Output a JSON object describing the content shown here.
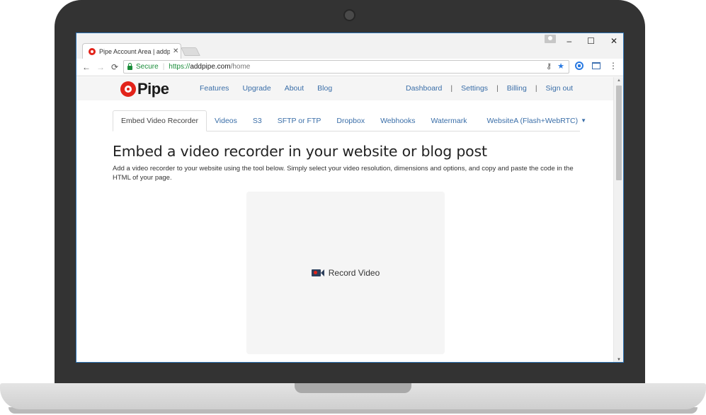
{
  "browser": {
    "tab_title": "Pipe Account Area | addp",
    "tab_close": "✕",
    "window_controls": {
      "minimize": "–",
      "maximize": "☐",
      "close": "✕"
    },
    "nav": {
      "back": "←",
      "forward": "→",
      "reload": "⟳"
    },
    "omnibox": {
      "secure_label": "Secure",
      "separator": "|",
      "url_protocol": "https://",
      "url_host": "addpipe.com",
      "url_path": "/home"
    },
    "menu": "⋮"
  },
  "site": {
    "logo_text": "Pipe",
    "nav_left": [
      "Features",
      "Upgrade",
      "About",
      "Blog"
    ],
    "nav_right": [
      "Dashboard",
      "Settings",
      "Billing",
      "Sign out"
    ],
    "divider": "|"
  },
  "tabs": [
    "Embed Video Recorder",
    "Videos",
    "S3",
    "SFTP or FTP",
    "Dropbox",
    "Webhooks",
    "Watermark",
    "WebsiteA (Flash+WebRTC)"
  ],
  "tab_caret": "▼",
  "main": {
    "heading": "Embed a video recorder in your website or blog post",
    "description": "Add a video recorder to your website using the tool below. Simply select your video resolution, dimensions and options, and copy and paste the code in the HTML of your page.",
    "record_button_label": "Record Video"
  },
  "colors": {
    "brand_red": "#e2231a",
    "link_blue": "#3a6ea8",
    "secure_green": "#1a8d3a",
    "laptop_bezel": "#333333"
  }
}
